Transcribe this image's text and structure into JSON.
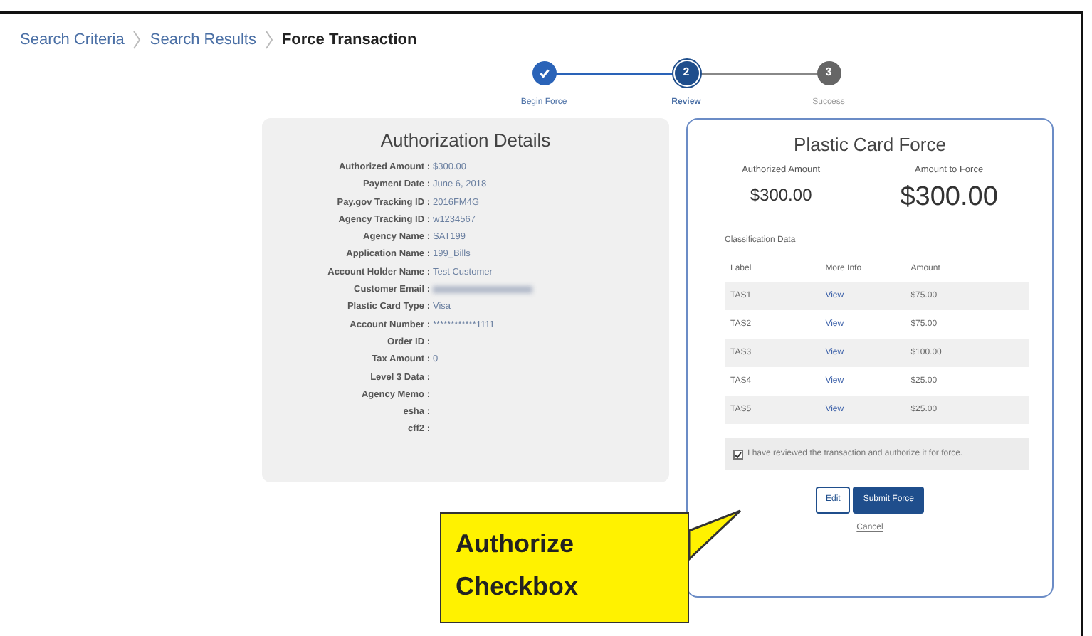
{
  "breadcrumb": [
    {
      "label": "Search Criteria",
      "current": false
    },
    {
      "label": "Search Results",
      "current": false
    },
    {
      "label": "Force Transaction",
      "current": true
    }
  ],
  "steps": [
    {
      "label": "Begin Force",
      "done": true,
      "selected": false
    },
    {
      "number": "2",
      "label": "Review",
      "done": false,
      "selected": true
    },
    {
      "number": "3",
      "label": "Success",
      "done": false,
      "selected": false
    }
  ],
  "authorization_details": {
    "title": "Authorization Details",
    "fields": [
      {
        "label": "Authorized Amount :",
        "value": "$300.00"
      },
      {
        "label": "Payment Date :",
        "value": "June 6, 2018"
      },
      {
        "label": "Pay.gov Tracking ID :",
        "value": "2016FM4G"
      },
      {
        "label": "Agency Tracking ID :",
        "value": "w1234567"
      },
      {
        "label": "Agency Name :",
        "value": "SAT199"
      },
      {
        "label": "Application Name :",
        "value": "199_Bills"
      },
      {
        "label": "Account Holder Name :",
        "value": "Test Customer"
      },
      {
        "label": "Customer Email :",
        "blurred": true
      },
      {
        "label": "Plastic Card Type :",
        "value": "Visa"
      },
      {
        "label": "Account Number :",
        "value": "************1111"
      },
      {
        "label": "Order ID :"
      },
      {
        "label": "Tax Amount :",
        "value": "0"
      },
      {
        "label": "Level 3 Data :"
      },
      {
        "label": "Agency Memo :"
      },
      {
        "label": "esha :"
      },
      {
        "label": "cff2 :"
      }
    ]
  },
  "plastic_card_force": {
    "title": "Plastic Card Force",
    "authorized_amount_label": "Authorized Amount",
    "authorized_amount": "$300.00",
    "amount_to_force_label": "Amount to Force",
    "amount_to_force": "$300.00",
    "classification_title": "Classification Data",
    "columns": [
      "Label",
      "More Info",
      "Amount"
    ],
    "rows": [
      {
        "label": "TAS1",
        "link": "View",
        "amount": "$75.00"
      },
      {
        "label": "TAS2",
        "link": "View",
        "amount": "$75.00"
      },
      {
        "label": "TAS3",
        "link": "View",
        "amount": "$100.00"
      },
      {
        "label": "TAS4",
        "link": "View",
        "amount": "$25.00"
      },
      {
        "label": "TAS5",
        "link": "View",
        "amount": "$25.00"
      }
    ],
    "authorize": {
      "text": "I have reviewed the transaction and authorize it for force.",
      "checked": true
    },
    "buttons": [
      {
        "label": "Edit",
        "kind": "secondary"
      },
      {
        "label": "Submit Force",
        "kind": "primary"
      }
    ],
    "cancel": "Cancel"
  },
  "callout": {
    "text": "Authorize Checkbox"
  }
}
